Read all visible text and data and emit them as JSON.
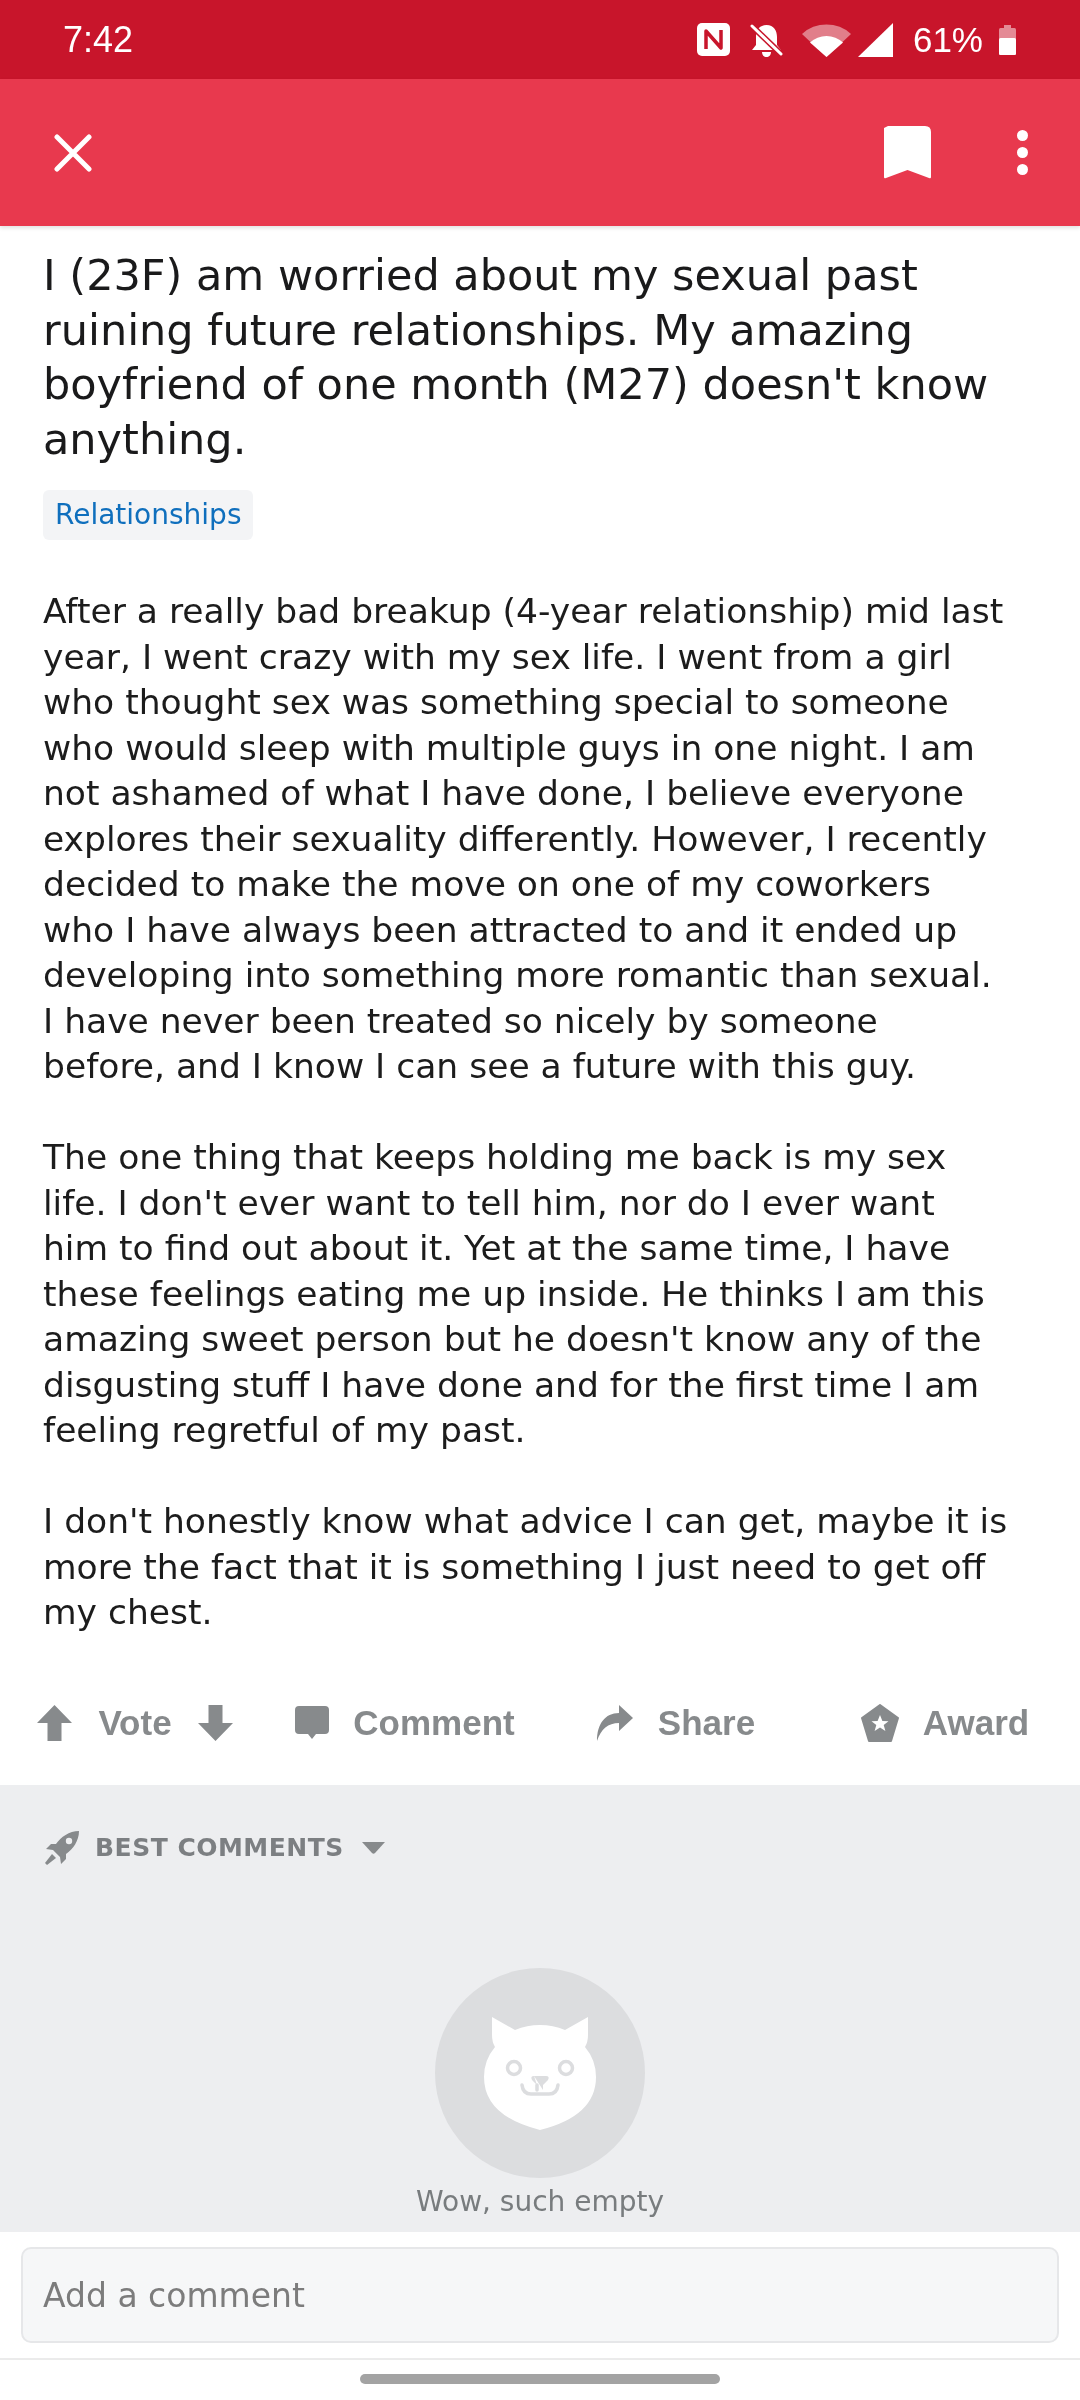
{
  "status_bar": {
    "time": "7:42",
    "battery": "61%"
  },
  "post": {
    "title": "I (23F) am worried about my sexual past ruining future relationships. My amazing boyfriend of one month (M27) doesn't know anything.",
    "flair": "Relationships",
    "body": [
      "After a really bad breakup (4-year relationship) mid last year, I went crazy with my sex life. I went from a girl who thought sex was something special to someone who would sleep with multiple guys in one night. I am not ashamed of what I have done, I believe everyone explores their sexuality differently. However, I recently decided to make the move on one of my coworkers who I have always been attracted to and it ended up developing into something more romantic than sexual. I have never been treated so nicely by someone before, and I know I can see a future with this guy.",
      "The one thing that keeps holding me back is my sex life. I don't ever want to tell him, nor do I ever want him to find out about it. Yet at the same time, I have these feelings eating me up inside. He thinks I am this amazing sweet person but he doesn't know any of the disgusting stuff I have done and for the first time I am feeling regretful of my past.",
      "I don't honestly know what advice I can get, maybe it is more the fact that it is something I just need to get off my chest."
    ]
  },
  "actions": [
    {
      "kind": "vote",
      "label": "Vote"
    },
    {
      "kind": "comment",
      "label": "Comment"
    },
    {
      "kind": "share",
      "label": "Share"
    },
    {
      "kind": "award",
      "label": "Award"
    }
  ],
  "comments": {
    "sort": "BEST COMMENTS",
    "empty_message": "Wow, such empty"
  },
  "comment_input": {
    "placeholder": "Add a comment"
  }
}
